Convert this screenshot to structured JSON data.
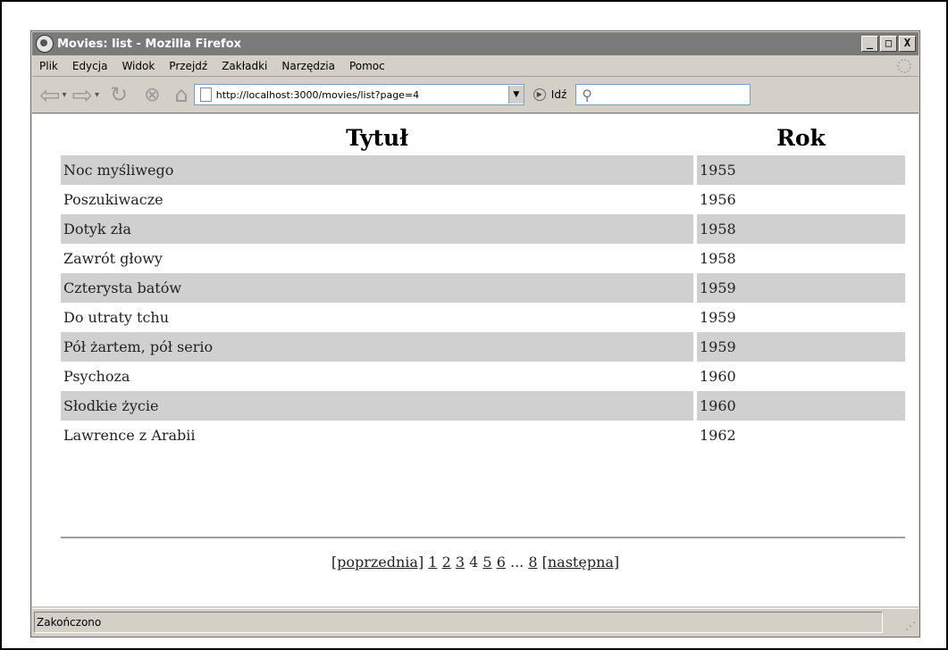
{
  "window": {
    "title": "Movies: list - Mozilla Firefox",
    "buttons": [
      "_",
      "□",
      "X"
    ]
  },
  "menu": [
    "Plik",
    "Edycja",
    "Widok",
    "Przejdź",
    "Zakładki",
    "Narzędzia",
    "Pomoc"
  ],
  "toolbar": {
    "url": "http://localhost:3000/movies/list?page=4",
    "go_label": "Idź"
  },
  "table": {
    "headers": {
      "title": "Tytuł",
      "year": "Rok"
    },
    "rows": [
      {
        "title": "Noc myśliwego",
        "year": "1955"
      },
      {
        "title": "Poszukiwacze",
        "year": "1956"
      },
      {
        "title": "Dotyk zła",
        "year": "1958"
      },
      {
        "title": "Zawrót głowy",
        "year": "1958"
      },
      {
        "title": "Czterysta batów",
        "year": "1959"
      },
      {
        "title": "Do utraty tchu",
        "year": "1959"
      },
      {
        "title": "Pół żartem, pół serio",
        "year": "1959"
      },
      {
        "title": "Psychoza",
        "year": "1960"
      },
      {
        "title": "Słodkie życie",
        "year": "1960"
      },
      {
        "title": "Lawrence z Arabii",
        "year": "1962"
      }
    ]
  },
  "pagination": {
    "prev": "[poprzednia]",
    "p1": "1",
    "p2": "2",
    "p3": "3",
    "current": "4",
    "p5": "5",
    "p6": "6",
    "ellipsis": "...",
    "p8": "8",
    "next": "[następna]"
  },
  "status": {
    "text": "Zakończono"
  }
}
